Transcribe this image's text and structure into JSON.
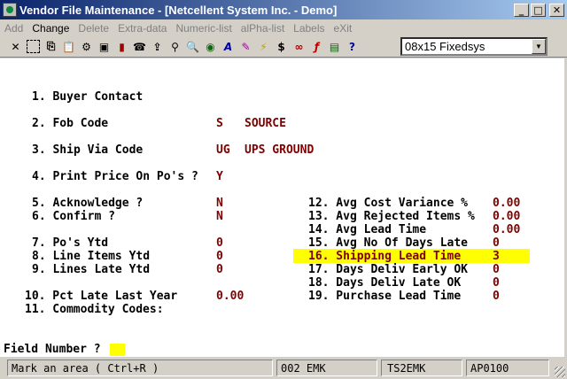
{
  "window": {
    "title": "Vendor File Maintenance - [Netcellent System Inc. - Demo]"
  },
  "menu": [
    {
      "label": "Add",
      "enabled": false
    },
    {
      "label": "Change",
      "enabled": true
    },
    {
      "label": "Delete",
      "enabled": false
    },
    {
      "label": "Extra-data",
      "enabled": false
    },
    {
      "label": "Numeric-list",
      "enabled": false
    },
    {
      "label": "alPha-list",
      "enabled": false
    },
    {
      "label": "Labels",
      "enabled": false
    },
    {
      "label": "eXit",
      "enabled": false
    }
  ],
  "toolbar": {
    "font_select": "08x15 Fixedsys"
  },
  "fields": {
    "f1": {
      "label": "1. Buyer Contact"
    },
    "f2": {
      "label": "2. Fob Code",
      "code": "S",
      "desc": "SOURCE"
    },
    "f3": {
      "label": "3. Ship Via Code",
      "code": "UG",
      "desc": "UPS GROUND"
    },
    "f4": {
      "label": "4. Print Price On Po's ?",
      "value": "Y"
    },
    "f5": {
      "label": "5. Acknowledge ?",
      "value": "N"
    },
    "f6": {
      "label": "6. Confirm ?",
      "value": "N"
    },
    "f7": {
      "label": "7. Po's Ytd",
      "value": "0"
    },
    "f8": {
      "label": "8. Line Items Ytd",
      "value": "0"
    },
    "f9": {
      "label": "9. Lines Late Ytd",
      "value": "0"
    },
    "f10": {
      "label": "10. Pct Late Last Year",
      "value": "0.00"
    },
    "f11": {
      "label": "11. Commodity Codes:"
    },
    "f12": {
      "label": "12. Avg Cost Variance %",
      "value": "0.00"
    },
    "f13": {
      "label": "13. Avg Rejected Items %",
      "value": "0.00"
    },
    "f14": {
      "label": "14. Avg Lead Time",
      "value": "0.00"
    },
    "f15": {
      "label": "15. Avg No Of Days Late",
      "value": "0"
    },
    "f16": {
      "label": "16. Shipping Lead Time",
      "value": "3"
    },
    "f17": {
      "label": "17. Days Deliv Early OK",
      "value": "0"
    },
    "f18": {
      "label": "18. Days Deliv Late OK",
      "value": "0"
    },
    "f19": {
      "label": "19. Purchase Lead Time",
      "value": "0"
    }
  },
  "prompt": {
    "label": "Field Number ?"
  },
  "status": {
    "message": "Mark an area ( Ctrl+R )",
    "company": "002 EMK",
    "terminal": "TS2EMK",
    "program": "AP0100"
  },
  "colors": {
    "value": "#800000",
    "highlight": "#ffff00",
    "titlebar": "#0a246a"
  }
}
